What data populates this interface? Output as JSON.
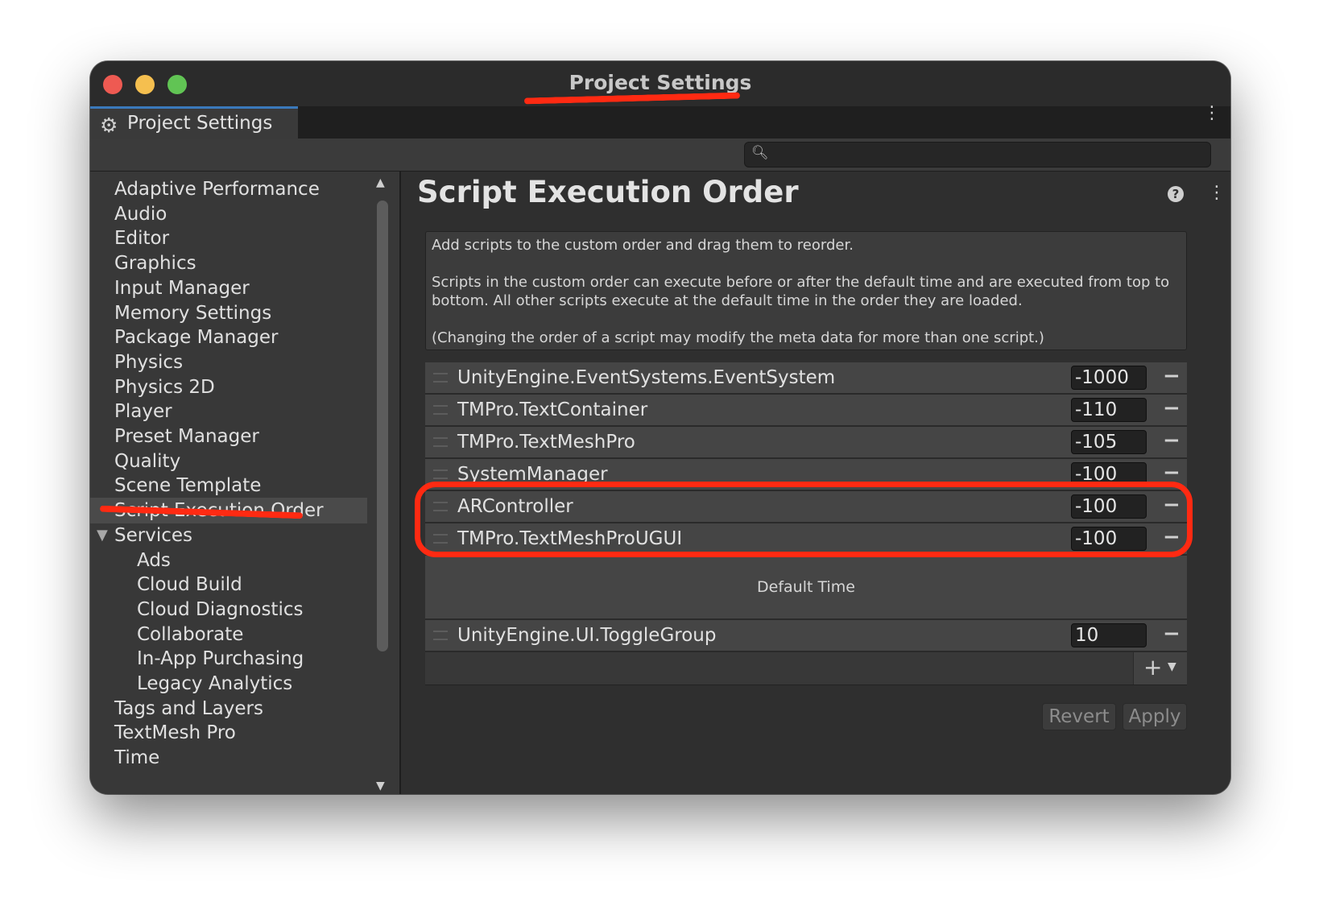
{
  "window": {
    "title": "Project Settings"
  },
  "tab": {
    "label": "Project Settings",
    "icon": "gear-icon"
  },
  "search": {
    "placeholder": ""
  },
  "sidebar": {
    "items": [
      {
        "label": "Adaptive Performance",
        "level": 0
      },
      {
        "label": "Audio",
        "level": 0
      },
      {
        "label": "Editor",
        "level": 0
      },
      {
        "label": "Graphics",
        "level": 0
      },
      {
        "label": "Input Manager",
        "level": 0
      },
      {
        "label": "Memory Settings",
        "level": 0
      },
      {
        "label": "Package Manager",
        "level": 0
      },
      {
        "label": "Physics",
        "level": 0
      },
      {
        "label": "Physics 2D",
        "level": 0
      },
      {
        "label": "Player",
        "level": 0
      },
      {
        "label": "Preset Manager",
        "level": 0
      },
      {
        "label": "Quality",
        "level": 0
      },
      {
        "label": "Scene Template",
        "level": 0
      },
      {
        "label": "Script Execution Order",
        "level": 0,
        "selected": true
      },
      {
        "label": "Services",
        "level": 0,
        "expanded": true
      },
      {
        "label": "Ads",
        "level": 1
      },
      {
        "label": "Cloud Build",
        "level": 1
      },
      {
        "label": "Cloud Diagnostics",
        "level": 1
      },
      {
        "label": "Collaborate",
        "level": 1
      },
      {
        "label": "In-App Purchasing",
        "level": 1
      },
      {
        "label": "Legacy Analytics",
        "level": 1
      },
      {
        "label": "Tags and Layers",
        "level": 0
      },
      {
        "label": "TextMesh Pro",
        "level": 0
      },
      {
        "label": "Time",
        "level": 0
      }
    ]
  },
  "main": {
    "title": "Script Execution Order",
    "help": {
      "line1": "Add scripts to the custom order and drag them to reorder.",
      "line2": "Scripts in the custom order can execute before or after the default time and are executed from top to bottom. All other scripts execute at the default time in the order they are loaded.",
      "line3": "(Changing the order of a script may modify the meta data for more than one script.)"
    },
    "scripts_before": [
      {
        "name": "UnityEngine.EventSystems.EventSystem",
        "value": "-1000"
      },
      {
        "name": "TMPro.TextContainer",
        "value": "-110"
      },
      {
        "name": "TMPro.TextMeshPro",
        "value": "-105"
      },
      {
        "name": "SystemManager",
        "value": "-100",
        "partially_hidden": true
      },
      {
        "name": "ARController",
        "value": "-100",
        "highlighted": true
      },
      {
        "name": "TMPro.TextMeshProUGUI",
        "value": "-100",
        "partially_hidden": true
      }
    ],
    "default_time_label": "Default Time",
    "scripts_after": [
      {
        "name": "UnityEngine.UI.ToggleGroup",
        "value": "10"
      }
    ],
    "buttons": {
      "revert": "Revert",
      "apply": "Apply"
    }
  },
  "colors": {
    "window_bg": "#2f2f2f",
    "sidebar_bg": "#383838",
    "selected_bg": "#4a4a4a",
    "accent_tab": "#3a79bb",
    "annotation": "#ff2a12"
  }
}
